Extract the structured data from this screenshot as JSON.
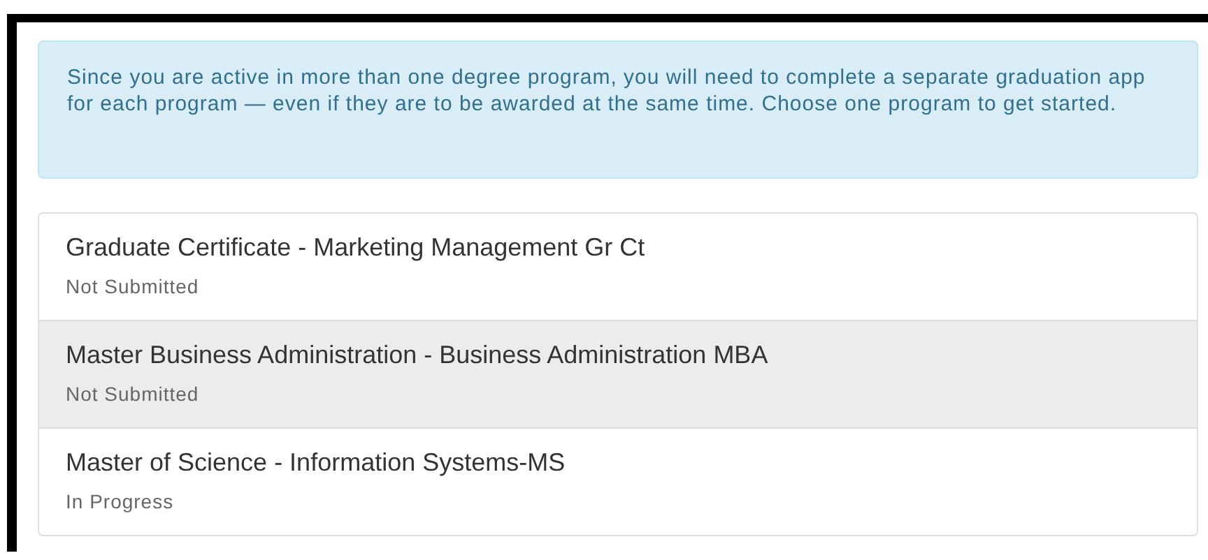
{
  "alert": {
    "text": "Since you are active in more than one degree program, you will need to complete a separate graduation app for each program — even if they are to be awarded at the same time. Choose one program to get started."
  },
  "programs": [
    {
      "title": "Graduate Certificate - Marketing Management Gr Ct",
      "status": "Not Submitted",
      "highlighted": false
    },
    {
      "title": "Master Business Administration - Business Administration MBA",
      "status": "Not Submitted",
      "highlighted": true
    },
    {
      "title": "Master of Science - Information Systems-MS",
      "status": "In Progress",
      "highlighted": false
    }
  ]
}
